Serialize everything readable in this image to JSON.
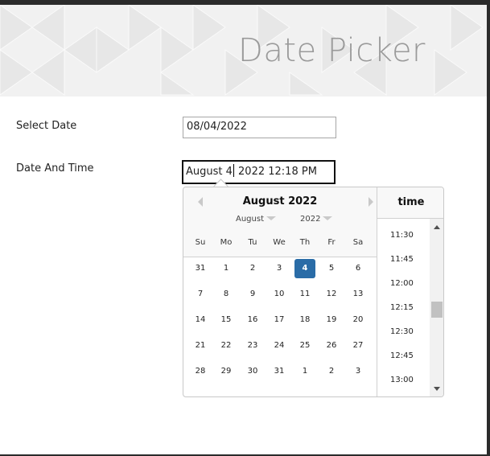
{
  "banner": {
    "title": "Date Picker"
  },
  "form": {
    "select_date_label": "Select Date",
    "select_date_value": "08/04/2022",
    "date_time_label": "Date And Time",
    "date_time_value_before_caret": "August 4",
    "date_time_value_after_caret": " 2022 12:18 PM"
  },
  "calendar": {
    "title": "August 2022",
    "month_select": "August",
    "year_select": "2022",
    "weekdays": [
      "Su",
      "Mo",
      "Tu",
      "We",
      "Th",
      "Fr",
      "Sa"
    ],
    "weeks": [
      [
        "31",
        "1",
        "2",
        "3",
        "4",
        "5",
        "6"
      ],
      [
        "7",
        "8",
        "9",
        "10",
        "11",
        "12",
        "13"
      ],
      [
        "14",
        "15",
        "16",
        "17",
        "18",
        "19",
        "20"
      ],
      [
        "21",
        "22",
        "23",
        "24",
        "25",
        "26",
        "27"
      ],
      [
        "28",
        "29",
        "30",
        "31",
        "1",
        "2",
        "3"
      ]
    ],
    "selected_day": "4",
    "accent_color": "#2a6ca7"
  },
  "time": {
    "header": "time",
    "items": [
      "11:30",
      "11:45",
      "12:00",
      "12:15",
      "12:30",
      "12:45",
      "13:00"
    ]
  },
  "icons": {
    "prev": "chevron-left-icon",
    "next": "chevron-right-icon",
    "dropdown": "caret-down-icon",
    "scroll_up": "scroll-up-arrow-icon",
    "scroll_down": "scroll-down-arrow-icon"
  }
}
